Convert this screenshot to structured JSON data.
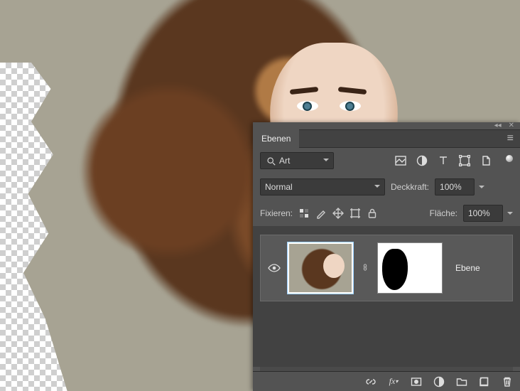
{
  "panel": {
    "tab_label": "Ebenen",
    "search": {
      "label": "Art"
    },
    "filter_icons": [
      "image-icon",
      "adjustment-icon",
      "type-icon",
      "shape-icon",
      "smartobject-icon"
    ],
    "blend_mode": "Normal",
    "opacity_label": "Deckkraft:",
    "opacity_value": "100%",
    "lock_label": "Fixieren:",
    "fill_label": "Fläche:",
    "fill_value": "100%",
    "layer": {
      "name": "Ebene"
    }
  }
}
